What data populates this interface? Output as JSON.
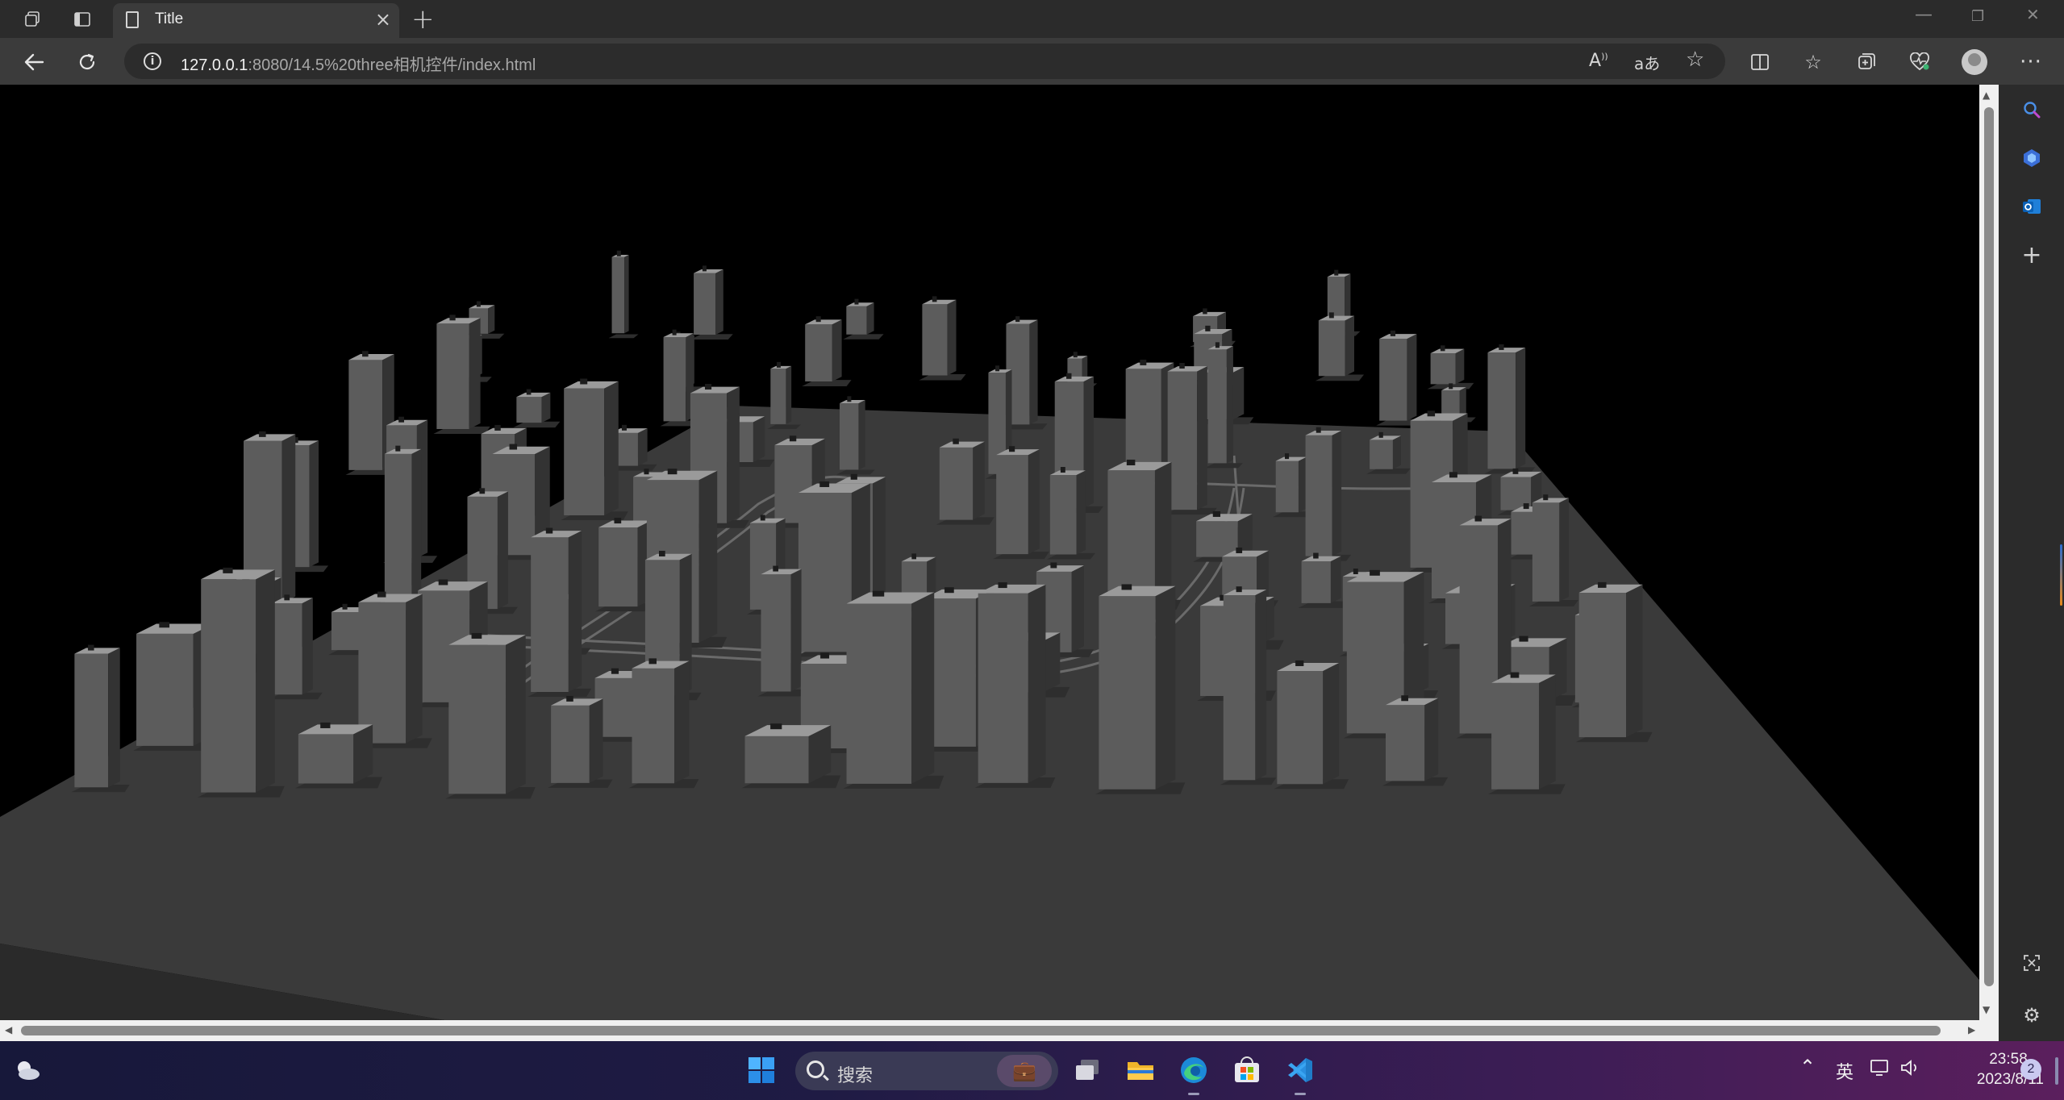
{
  "browser": {
    "tab": {
      "title": "Title",
      "close_glyph": "×"
    },
    "address": {
      "host": "127.0.0.1",
      "path": ":8080/14.5%20three相机控件/index.html"
    },
    "window_controls": {
      "minimize": "—",
      "restore": "❐",
      "close": "✕"
    }
  },
  "scene": {
    "description_hidden": "",
    "ground_color": "#3a3a3a",
    "building_top_color": "#9a9a9a",
    "building_side_light": "#5c5c5c",
    "building_side_dark": "#333333"
  },
  "taskbar": {
    "search_placeholder": "搜索",
    "ime": "英",
    "time": "23:58",
    "date": "2023/8/11",
    "notification_count": "2"
  },
  "icons": {
    "workspaces": "workspaces-icon",
    "tab_actions": "tab-actions-icon",
    "back": "back-arrow-icon",
    "refresh": "refresh-icon",
    "info": "info-icon",
    "read_aloud": "read-aloud-icon",
    "translate": "translate-icon",
    "favorite": "star-icon",
    "split": "split-screen-icon",
    "favorites": "favorites-icon",
    "collections": "collections-icon",
    "performance": "browser-essentials-icon",
    "profile": "profile-avatar",
    "more": "more-icon"
  },
  "colors": {
    "tabbar": "#2b2b2b",
    "navbar": "#3b3b3b",
    "accent_edge": "#2f8ed8",
    "vscode": "#2a8fe0"
  }
}
